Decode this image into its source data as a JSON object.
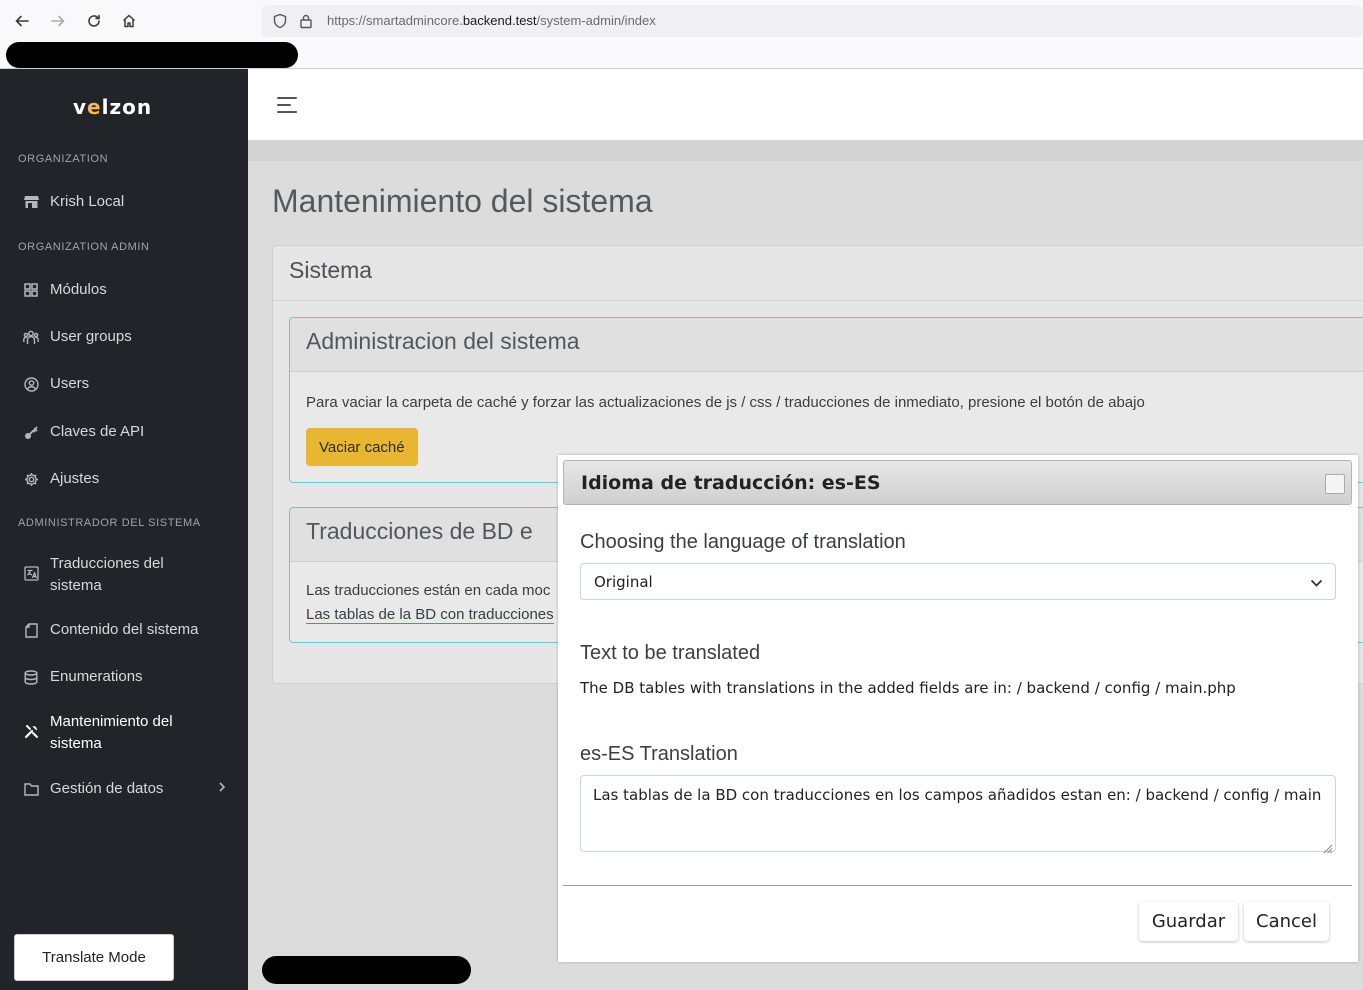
{
  "browser": {
    "url_prefix": "https://smartadmincore.",
    "url_domain": "backend.test",
    "url_path": "/system-admin/index"
  },
  "sidebar": {
    "logo_main_1": "v",
    "logo_main_2": "e",
    "logo_main_3": "lzon",
    "sections": {
      "organization": "ORGANIZATION",
      "organization_admin": "ORGANIZATION ADMIN",
      "system_admin": "ADMINISTRADOR DEL SISTEMA"
    },
    "items": {
      "krish_local": "Krish Local",
      "modulos": "Módulos",
      "user_groups": "User groups",
      "users": "Users",
      "claves_api": "Claves de API",
      "ajustes": "Ajustes",
      "traducciones": "Traducciones del sistema",
      "contenido": "Contenido del sistema",
      "enumerations": "Enumerations",
      "mantenimiento": "Mantenimiento del sistema",
      "gestion": "Gestión de datos"
    },
    "translate_mode": "Translate Mode"
  },
  "main": {
    "page_title": "Mantenimiento del sistema",
    "card_title": "Sistema",
    "admin_card": {
      "title": "Administracion del sistema",
      "description": "Para vaciar la carpeta de caché y forzar las actualizaciones de js / css / traducciones de inmediato, presione el botón de abajo",
      "button": "Vaciar caché"
    },
    "db_card": {
      "title": "Traducciones de BD e",
      "line1": "Las traducciones están en cada moc",
      "line2": "Las tablas de la BD con traducciones"
    }
  },
  "modal": {
    "title": "Idioma de traducción: es-ES",
    "choose_label": "Choosing the language of translation",
    "select_value": "Original",
    "text_label": "Text to be translated",
    "source_text": "The DB tables with translations in the added fields are in: / backend / config / main.php",
    "translation_label": "es-ES Translation",
    "translation_value": "Las tablas de la BD con traducciones en los campos añadidos estan en: / backend / config / main",
    "save_button": "Guardar",
    "cancel_button": "Cancel"
  },
  "colors": {
    "sidebar_bg": "#212529",
    "accent_yellow": "#e9b632",
    "info_border": "#6cc5d5"
  }
}
